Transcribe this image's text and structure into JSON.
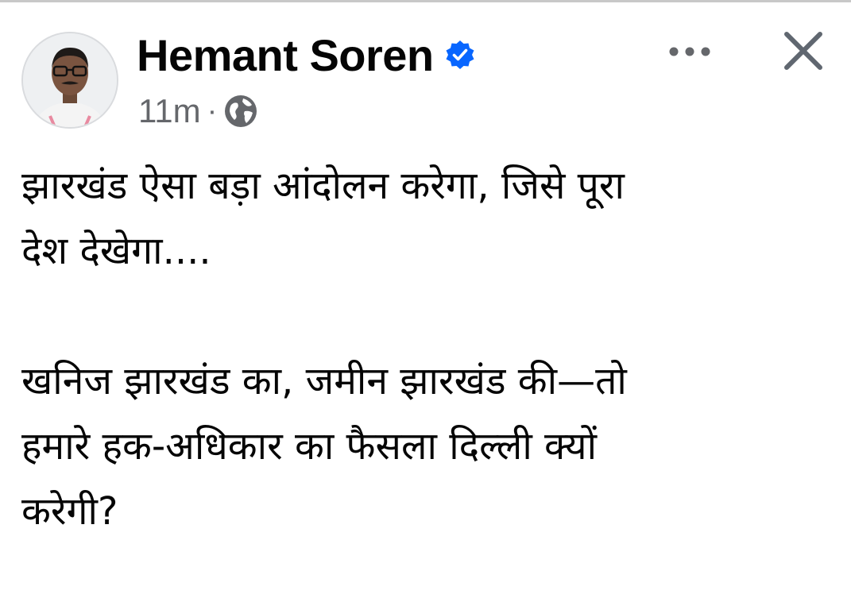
{
  "post": {
    "author_name": "Hemant Soren",
    "verified": true,
    "timestamp": "11m",
    "separator": "·",
    "audience_icon": "globe-icon",
    "more_icon": "more-horizontal-icon",
    "close_icon": "close-icon",
    "paragraphs": [
      "झारखंड ऐसा बड़ा आंदोलन करेगा, जिसे पूरा\nदेश देखेगा....",
      "खनिज झारखंड का, जमीन झारखंड की—तो\nहमारे हक-अधिकार का फैसला दिल्ली क्यों\nकरेगी?"
    ]
  },
  "colors": {
    "verified_blue": "#0866ff",
    "meta_gray": "#65676b",
    "text_black": "#050505"
  }
}
